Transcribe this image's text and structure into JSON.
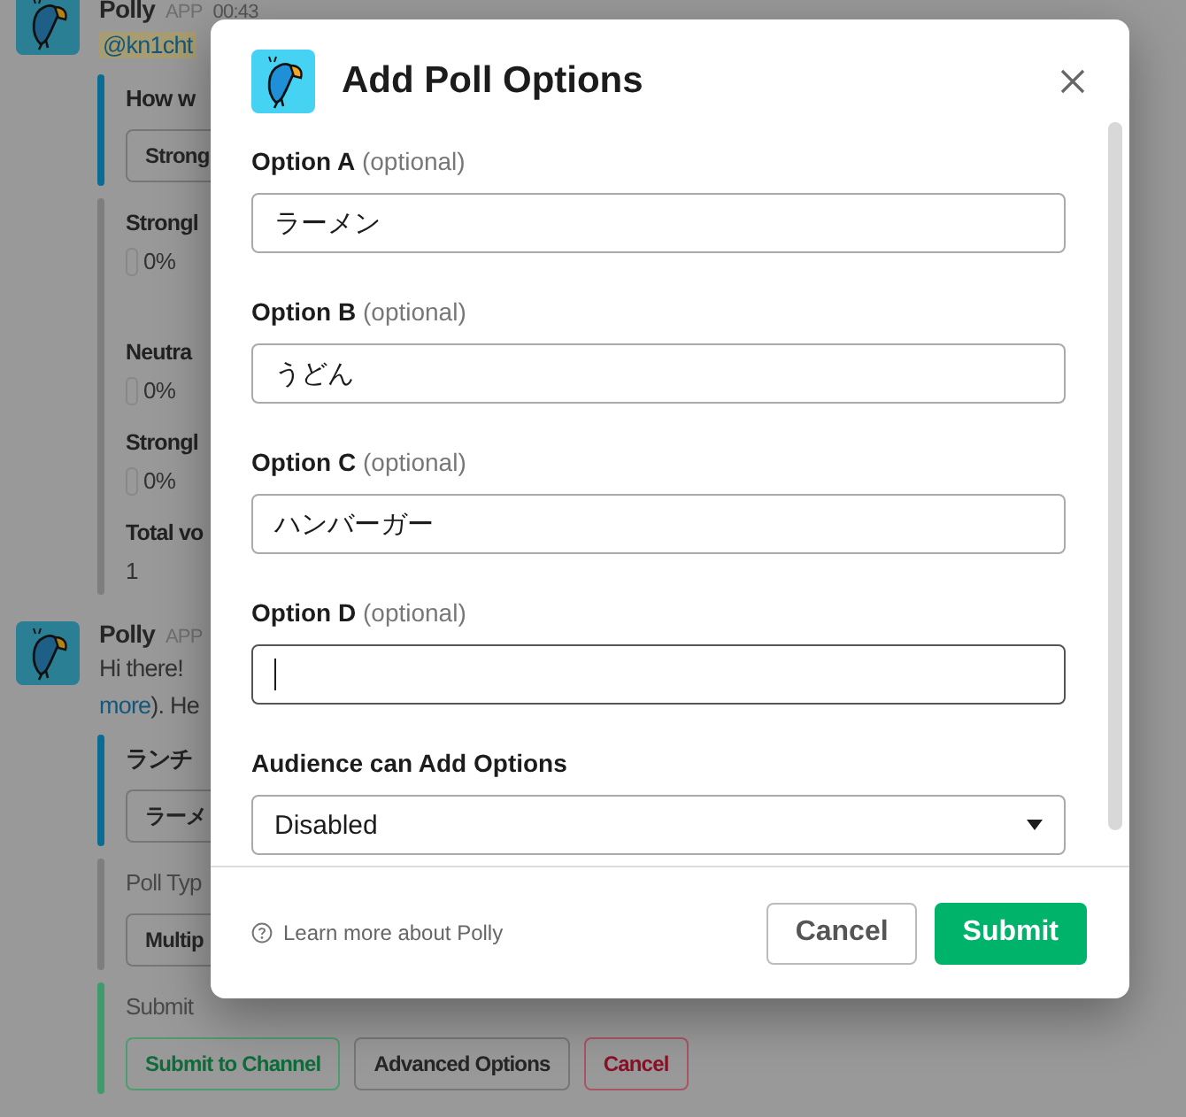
{
  "background": {
    "messages": [
      {
        "author": "Polly",
        "badge": "APP",
        "time": "00:43",
        "lines": [
          {
            "kind": "mention",
            "text": "@kn1cht"
          }
        ],
        "attachments": [
          {
            "kind": "question",
            "color": "#0b6c93",
            "title": "How w",
            "buttons": [
              {
                "label": "Strong",
                "kind": "default"
              }
            ]
          },
          {
            "kind": "results",
            "color": "#7e7e7e",
            "results": [
              {
                "kind": "result",
                "label": "Strongl",
                "percent": "0%"
              },
              {
                "kind": "spacer"
              },
              {
                "kind": "result",
                "label": "Neutra",
                "percent": "0%"
              },
              {
                "kind": "result",
                "label": "Strongl",
                "percent": "0%"
              }
            ],
            "total_label": "Total vo",
            "total": "1"
          }
        ]
      },
      {
        "author": "Polly",
        "badge": "APP",
        "lines": [
          {
            "kind": "text",
            "text": "Hi there! "
          },
          {
            "kind": "link",
            "link": "more",
            "text": "). He"
          }
        ],
        "attachments": [
          {
            "kind": "question",
            "color": "#0b6c93",
            "title": "ランチ",
            "buttons": [
              {
                "label": "ラーメ",
                "kind": "default"
              }
            ]
          },
          {
            "kind": "section",
            "color": "#7e7e7e",
            "title": "Poll Typ",
            "buttons": [
              {
                "label": "Multip",
                "kind": "default"
              }
            ]
          },
          {
            "kind": "section",
            "color": "#3f9a6c",
            "title": "Submit",
            "buttons": [
              {
                "label": "Submit to Channel",
                "kind": "primary"
              },
              {
                "label": "Advanced Options",
                "kind": "default"
              },
              {
                "label": "Cancel",
                "kind": "danger"
              }
            ]
          }
        ]
      }
    ]
  },
  "dialog": {
    "title": "Add Poll Options",
    "fields": [
      {
        "kind": "text",
        "label": "**Option A** (optional)",
        "value": "ラーメン",
        "focused": false
      },
      {
        "kind": "text",
        "label": "**Option B** (optional)",
        "value": "うどん",
        "focused": false
      },
      {
        "kind": "text",
        "label": "**Option C** (optional)",
        "value": "ハンバーガー",
        "focused": false
      },
      {
        "kind": "text",
        "label": "**Option D** (optional)",
        "focused": true
      },
      {
        "kind": "select",
        "label": "Audience can Add Options",
        "value": "Disabled"
      }
    ],
    "help": "Learn more about Polly",
    "buttons": [
      {
        "label": "Cancel",
        "kind": "secondary"
      },
      {
        "label": "Submit",
        "kind": "primary"
      }
    ]
  }
}
